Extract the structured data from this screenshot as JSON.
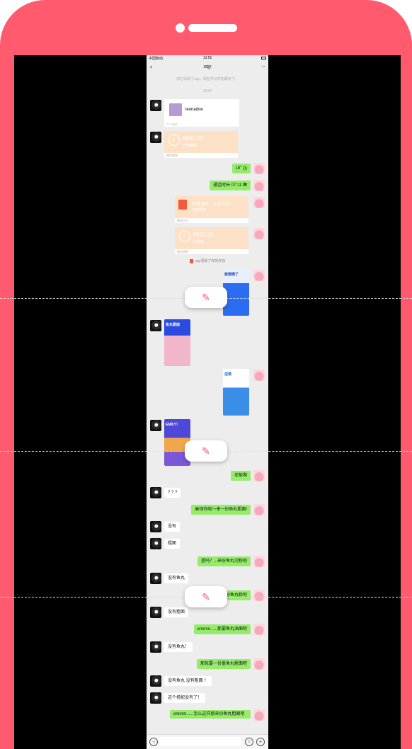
{
  "status_bar": {
    "carrier": "中国移动",
    "time": "13:55"
  },
  "nav": {
    "back": "‹",
    "title": "xqy",
    "more": "···"
  },
  "system": {
    "added_notice": "你已添加了xqy，现在可以开始聊天了。",
    "timestamp": "10:47",
    "red_packet_notice": "xqy领取了你的红包"
  },
  "card_contact": {
    "name": "leonadoe",
    "footer": "个人名片"
  },
  "transfer_received": {
    "amount": "¥631.00",
    "status": "已被接收",
    "footer": "微信转账"
  },
  "voice": {
    "duration": "18\""
  },
  "call": {
    "text": "通话时长  07:11"
  },
  "red_packet": {
    "title": "恭喜发财，大吉大利",
    "status": "已被领完",
    "footer": "微信红包"
  },
  "transfer_sent": {
    "amount": "¥631.00",
    "status": "已收钱",
    "footer": "微信转账"
  },
  "posters": [
    {
      "text": "就想撩了"
    },
    {
      "text": "鱼丸粗面"
    },
    {
      "text": "逆袭"
    },
    {
      "text": "EMILY！"
    }
  ],
  "messages": [
    {
      "side": "right",
      "text": "老板啊"
    },
    {
      "side": "left",
      "text": "? ? ?"
    },
    {
      "side": "right",
      "text": "麻烦你啦～来一份鱼丸粗面!"
    },
    {
      "side": "left",
      "text": "没有"
    },
    {
      "side": "left",
      "text": "粗面"
    },
    {
      "side": "right",
      "text": "是吗？...来份鱼丸河粉吧"
    },
    {
      "side": "left",
      "text": "没有鱼丸"
    },
    {
      "side": "right",
      "text": "...那就来份鱼丸粉吧"
    },
    {
      "side": "left",
      "text": "没有粗面"
    },
    {
      "side": "right",
      "text": "emmm......那要鱼丸油面吧"
    },
    {
      "side": "left",
      "text": "没有鱼丸！"
    },
    {
      "side": "right",
      "text": "那就要一份墨鱼丸粗面吧"
    },
    {
      "side": "left",
      "text": "没有鱼丸 没有粗面 ！"
    },
    {
      "side": "left",
      "text": "这个搭配没有了！"
    },
    {
      "side": "right",
      "text": "emmm......怎么这样那来份鱼丸粗面吧"
    }
  ],
  "input_bar": {
    "voice_icon": "◁",
    "emoji_icon": "☺",
    "plus_icon": "+"
  },
  "edit_icon": "✎"
}
